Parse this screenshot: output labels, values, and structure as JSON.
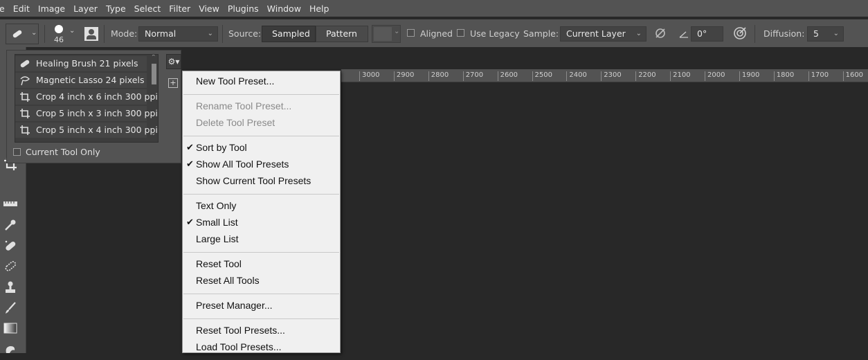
{
  "menubar": [
    "e",
    "Edit",
    "Image",
    "Layer",
    "Type",
    "Select",
    "Filter",
    "View",
    "Plugins",
    "Window",
    "Help"
  ],
  "options": {
    "brush_size": "46",
    "mode_label": "Mode:",
    "mode_value": "Normal",
    "source_label": "Source:",
    "source_sampled": "Sampled",
    "source_pattern": "Pattern",
    "aligned_label": "Aligned",
    "legacy_label": "Use Legacy",
    "sample_label": "Sample:",
    "sample_value": "Current Layer",
    "angle_value": "0°",
    "diffusion_label": "Diffusion:",
    "diffusion_value": "5"
  },
  "ruler": [
    "3000",
    "2900",
    "2800",
    "2700",
    "2600",
    "2500",
    "2400",
    "2300",
    "2200",
    "2100",
    "2000",
    "1900",
    "1800",
    "1700",
    "1600"
  ],
  "presets": {
    "items": [
      {
        "icon": "healing-brush-icon",
        "label": "Healing Brush 21 pixels"
      },
      {
        "icon": "magnetic-lasso-icon",
        "label": "Magnetic Lasso 24 pixels"
      },
      {
        "icon": "crop-icon",
        "label": "Crop 4 inch x 6 inch 300 ppi"
      },
      {
        "icon": "crop-icon",
        "label": "Crop 5 inch x 3 inch 300 ppi"
      },
      {
        "icon": "crop-icon",
        "label": "Crop 5 inch x 4 inch 300 ppi"
      }
    ],
    "current_tool_only": "Current Tool Only"
  },
  "context_menu": {
    "new_preset": "New Tool Preset...",
    "rename_preset": "Rename Tool Preset...",
    "delete_preset": "Delete Tool Preset",
    "sort_by_tool": "Sort by Tool",
    "show_all": "Show All Tool Presets",
    "show_current": "Show Current Tool Presets",
    "text_only": "Text Only",
    "small_list": "Small List",
    "large_list": "Large List",
    "reset_tool": "Reset Tool",
    "reset_all_tools": "Reset All Tools",
    "preset_manager": "Preset Manager...",
    "reset_presets": "Reset Tool Presets...",
    "load_presets": "Load Tool Presets...",
    "checked": [
      "sort_by_tool",
      "show_all",
      "small_list"
    ]
  }
}
